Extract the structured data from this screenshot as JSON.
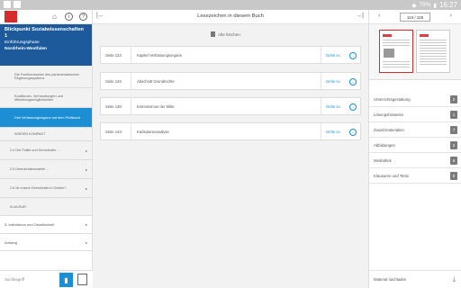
{
  "status": {
    "battery": "79%",
    "time": "16:27"
  },
  "app": {
    "logo_text": "Bildner Verlag",
    "book_title": "Blickpunkt Sozialwissenschaften 1",
    "book_phase": "Einführungsphase",
    "book_region": "Nordrhein-Westfalen"
  },
  "toc": [
    {
      "label": "Die Funktionsweise des parlamentarischen Regierungssystems",
      "level": 2
    },
    {
      "label": "Koalitionen, Verhandlungen und Mitwirkungsmöglichkeiten",
      "level": 2
    },
    {
      "label": "Drei Verfassungsorgane auf dem Prüfstand",
      "level": 2,
      "selected": true
    },
    {
      "label": "WISSEN KOMPAKT",
      "level": 2
    },
    {
      "label": "2.4 Die Politik und Demokratie …",
      "level": 1,
      "chevron": true
    },
    {
      "label": "2.5 Demokratiemodelle ...",
      "level": 1,
      "chevron": true
    },
    {
      "label": "2.6 Ist unsere Demokratie in Gefahr?",
      "level": 1,
      "chevron": true
    },
    {
      "label": "KLAUSUR",
      "level": 1
    },
    {
      "label": "3. Individuum und Gesellschaft",
      "level": 0,
      "chevron": true
    },
    {
      "label": "Anhang",
      "level": 0,
      "chevron": true
    }
  ],
  "search": {
    "placeholder": "Suchbegriff"
  },
  "middle": {
    "title": "Lesezeichen in diesem Buch",
    "delete_all": "Alle löschen",
    "bookmarks": [
      {
        "page": "Seite 124:",
        "text": "Kapitel Verfassungsorgane",
        "goto": "Gehe zu"
      },
      {
        "page": "Seite 134:",
        "text": "Abschnitt Grundrechte",
        "goto": "Gehe zu"
      },
      {
        "page": "Seite 138:",
        "text": "Extremismus der Mitte",
        "goto": "Gehe zu"
      },
      {
        "page": "Seite 144:",
        "text": "Karikaturenanalyse",
        "goto": "Gehe zu"
      }
    ]
  },
  "right": {
    "pages": "124 / 125",
    "resources": [
      {
        "label": "Unterrichtsgestaltung",
        "count": "2"
      },
      {
        "label": "Lösungshinweise",
        "count": "1"
      },
      {
        "label": "Zusatzmaterialien",
        "count": "7"
      },
      {
        "label": "Abbildungen",
        "count": "2"
      },
      {
        "label": "Mediathek",
        "count": "6"
      },
      {
        "label": "Klausuren und Tests",
        "count": "9"
      }
    ],
    "footer": "Material nachladen"
  }
}
